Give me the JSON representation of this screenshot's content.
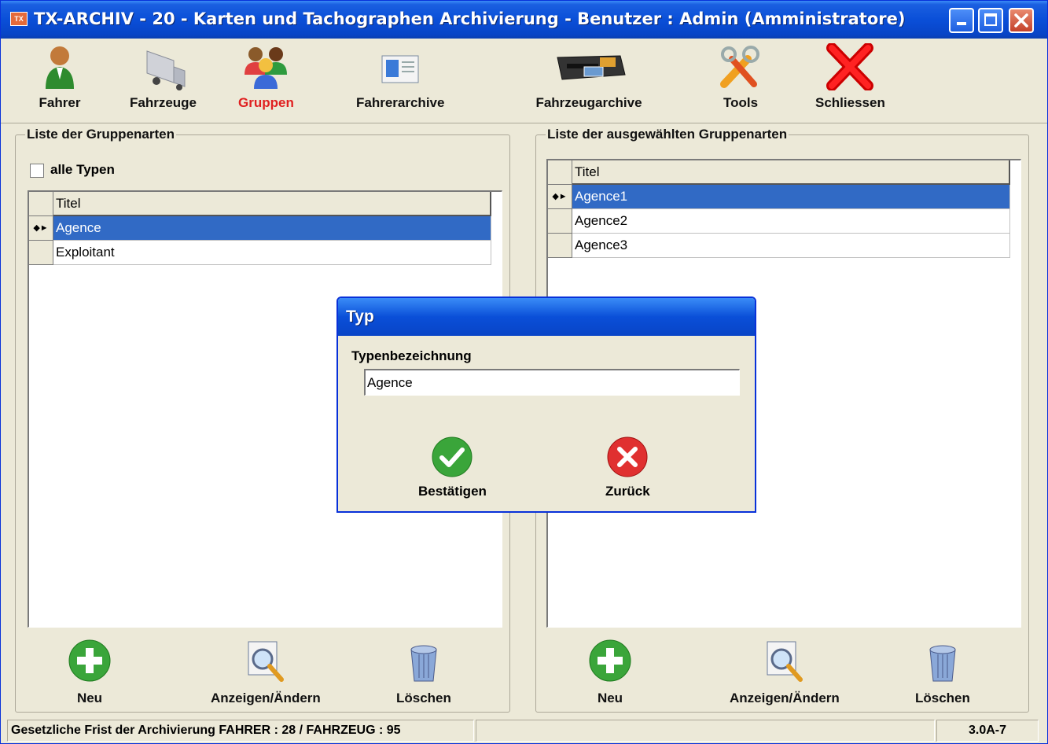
{
  "window": {
    "title": "TX-ARCHIV - 20 - Karten und Tachographen Archivierung - Benutzer : Admin (Amministratore)",
    "app_icon_text": "TX"
  },
  "toolbar": {
    "items": [
      {
        "label": "Fahrer",
        "icon": "driver-icon"
      },
      {
        "label": "Fahrzeuge",
        "icon": "truck-icon"
      },
      {
        "label": "Gruppen",
        "icon": "group-icon",
        "active": true
      },
      {
        "label": "Fahrerarchive",
        "icon": "card-icon"
      },
      {
        "label": "Fahrzeugarchive",
        "icon": "tachograph-icon"
      },
      {
        "label": "Tools",
        "icon": "tools-icon"
      },
      {
        "label": "Schliessen",
        "icon": "close-x-icon"
      }
    ],
    "active_color": "#e02020"
  },
  "left_panel": {
    "title": "Liste der Gruppenarten",
    "checkbox_label": "alle Typen",
    "checkbox_checked": false,
    "column_header": "Titel",
    "rows": [
      "Agence",
      "Exploitant"
    ],
    "selected_index": 0,
    "buttons": {
      "new": "Neu",
      "edit": "Anzeigen/Ändern",
      "delete": "Löschen"
    }
  },
  "right_panel": {
    "title": "Liste der ausgewählten Gruppenarten",
    "column_header": "Titel",
    "rows": [
      "Agence1",
      "Agence2",
      "Agence3"
    ],
    "selected_index": 0,
    "buttons": {
      "new": "Neu",
      "edit": "Anzeigen/Ändern",
      "delete": "Löschen"
    }
  },
  "dialog": {
    "title": "Typ",
    "field_label": "Typenbezeichnung",
    "field_value": "Agence",
    "confirm": "Bestätigen",
    "back": "Zurück"
  },
  "statusbar": {
    "text": "Gesetzliche Frist der Archivierung FAHRER  : 28 / FAHRZEUG : 95",
    "version": "3.0A-7"
  },
  "colors": {
    "selection": "#316ac5",
    "titlebar": "#0a4fd8",
    "face": "#ece9d8"
  }
}
